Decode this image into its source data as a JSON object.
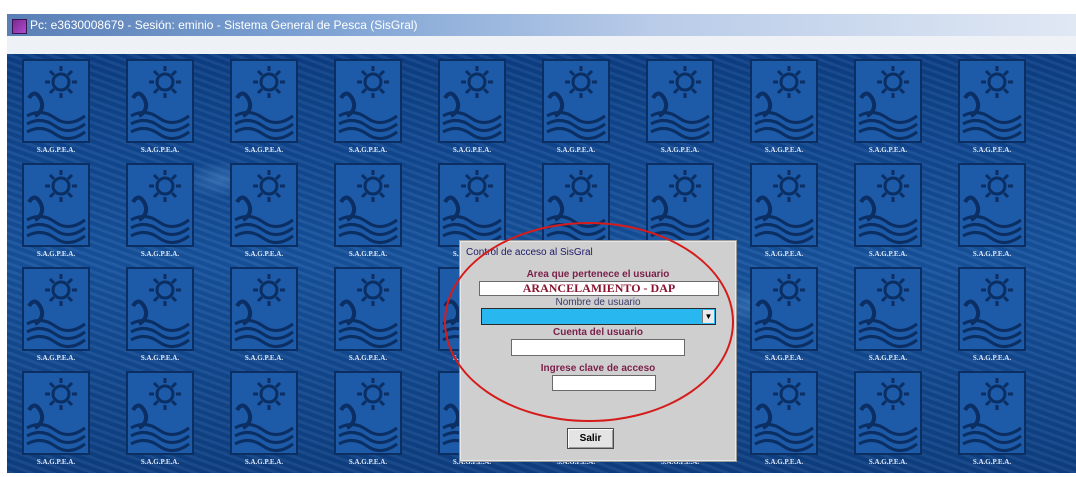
{
  "window": {
    "title": "Pc: e3630008679 - Sesión: eminio - Sistema General de Pesca (SisGral)"
  },
  "wallpaper": {
    "tile_label": "S.A.G.P.E.A.",
    "icon": "sun-waves-logo-icon"
  },
  "dialog": {
    "caption": "Control de acceso al SisGral",
    "area_label": "Area que pertenece el usuario",
    "area_value": "ARANCELAMIENTO - DAP",
    "username_label": "Nombre de usuario",
    "username_value": "",
    "account_label": "Cuenta del usuario",
    "account_value": "",
    "password_label": "Ingrese clave de acceso",
    "password_value": "",
    "exit_button": "Salir"
  },
  "colors": {
    "select_highlight": "#29b7ef",
    "label_color": "#7a1f4a",
    "annotation": "#d61b1b"
  }
}
